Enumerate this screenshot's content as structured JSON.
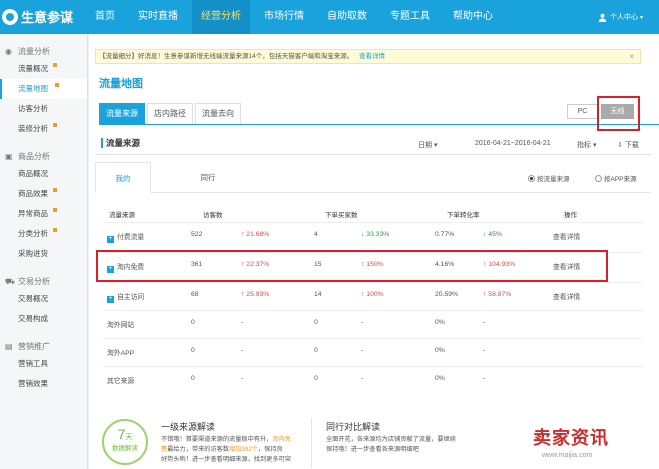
{
  "app": {
    "logo_text": "生意参谋"
  },
  "topnav": {
    "items": [
      {
        "label": "首页"
      },
      {
        "label": "实时直播"
      },
      {
        "label": "经营分析"
      },
      {
        "label": "市场行情"
      },
      {
        "label": "自助取数"
      },
      {
        "label": "专题工具"
      },
      {
        "label": "帮助中心"
      }
    ],
    "active_index": 2,
    "user_center": "个人中心"
  },
  "sidebar": {
    "groups": [
      {
        "title": "流量分析",
        "items": [
          "流量概况",
          "流量地图",
          "访客分析",
          "装修分析"
        ]
      },
      {
        "title": "商品分析",
        "items": [
          "商品概况",
          "商品效果",
          "异常商品",
          "分类分析",
          "采购进货"
        ]
      },
      {
        "title": "交易分析",
        "items": [
          "交易概况",
          "交易构成"
        ]
      },
      {
        "title": "营销推广",
        "items": [
          "营销工具",
          "营销效果"
        ]
      }
    ],
    "active_item": "流量地图"
  },
  "notice": {
    "text": "【流量细分】好消息！生意参谋新增无线端流量来源14个，包括天猫客户端和淘宝来源。",
    "link": "查看详情",
    "close": "×"
  },
  "page": {
    "title": "流量地图"
  },
  "tabs": [
    "流量来源",
    "店内路径",
    "流量去向"
  ],
  "device": {
    "pc": "PC",
    "wireless": "无线"
  },
  "section": {
    "title": "流量来源",
    "date_label": "日期",
    "date_range": "2016-04-21~2016-04-21",
    "metric_label": "指标",
    "download": "下载"
  },
  "subtabs": {
    "mine": "我的",
    "peer": "同行"
  },
  "radios": {
    "by_source": "按流量来源",
    "by_app": "按APP来源"
  },
  "table": {
    "headers": [
      "流量来源",
      "访客数",
      "下单买家数",
      "下单转化率",
      "操作"
    ],
    "rows": [
      {
        "name": "付费流量",
        "visitors": "522",
        "vis_change": "21.68%",
        "vis_dir": "up",
        "buyers": "4",
        "buy_change": "33.33%",
        "buy_dir": "down",
        "rate": "0.77%",
        "rate_change": "45%",
        "rate_dir": "down",
        "action": "查看详情",
        "expandable": true
      },
      {
        "name": "淘内免费",
        "visitors": "361",
        "vis_change": "22.37%",
        "vis_dir": "up",
        "buyers": "15",
        "buy_change": "150%",
        "buy_dir": "up",
        "rate": "4.16%",
        "rate_change": "104.93%",
        "rate_dir": "up",
        "action": "查看详情",
        "expandable": true
      },
      {
        "name": "自主访问",
        "visitors": "68",
        "vis_change": "25.93%",
        "vis_dir": "up",
        "buyers": "14",
        "buy_change": "100%",
        "buy_dir": "up",
        "rate": "20.59%",
        "rate_change": "58.87%",
        "rate_dir": "up",
        "action": "查看详情",
        "expandable": true
      },
      {
        "name": "淘外网站",
        "visitors": "0",
        "vis_change": "-",
        "vis_dir": "",
        "buyers": "0",
        "buy_change": "-",
        "buy_dir": "",
        "rate": "0%",
        "rate_change": "-",
        "rate_dir": "",
        "action": "",
        "expandable": false
      },
      {
        "name": "淘外APP",
        "visitors": "0",
        "vis_change": "-",
        "vis_dir": "",
        "buyers": "0",
        "buy_change": "-",
        "buy_dir": "",
        "rate": "0%",
        "rate_change": "-",
        "rate_dir": "",
        "action": "",
        "expandable": false
      },
      {
        "name": "其它来源",
        "visitors": "0",
        "vis_change": "-",
        "vis_dir": "",
        "buyers": "0",
        "buy_change": "-",
        "buy_dir": "",
        "rate": "0%",
        "rate_change": "-",
        "rate_dir": "",
        "action": "",
        "expandable": false
      }
    ]
  },
  "bottom": {
    "badge_num": "7",
    "badge_unit": "天",
    "badge_text": "数据解读",
    "interp1_title": "一级来源解读",
    "interp1_line1_a": "不错哦！首要渠道来源的流量稳中有升，",
    "interp1_line1_hl": "淘内免",
    "interp1_line2_hl": "费",
    "interp1_line2_a": "最给力，带来的访客数",
    "interp1_line2_hl2": "增加392个",
    "interp1_line2_b": "，保持良",
    "interp1_line3": "好势头哟！进一步查看明细来源，找到更多可突",
    "interp2_title": "同行对比解读",
    "interp2_line1": "全面开花，各来源均为店铺贡献了流量，要继续",
    "interp2_line2": "保持哦！进一步查看各来源明细吧"
  },
  "watermark": {
    "text": "卖家资讯",
    "url": "www.maijia.com"
  }
}
